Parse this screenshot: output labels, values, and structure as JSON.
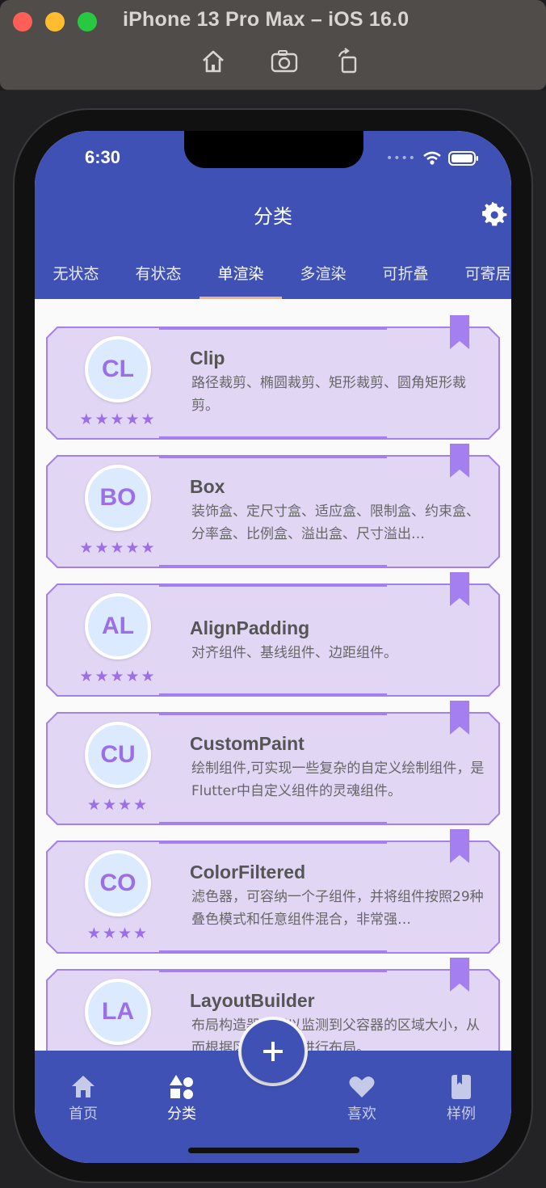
{
  "simulator": {
    "title": "iPhone 13 Pro Max – iOS 16.0",
    "tools": [
      "home-icon",
      "screenshot-icon",
      "rotate-icon"
    ]
  },
  "status_bar": {
    "time": "6:30"
  },
  "app_bar": {
    "title": "分类"
  },
  "tabs": [
    {
      "label": "无状态",
      "active": false
    },
    {
      "label": "有状态",
      "active": false
    },
    {
      "label": "单渲染",
      "active": true
    },
    {
      "label": "多渲染",
      "active": false
    },
    {
      "label": "可折叠",
      "active": false
    },
    {
      "label": "可寄居",
      "active": false
    }
  ],
  "items": [
    {
      "avatar": "CL",
      "title": "Clip",
      "stars": "★★★★★",
      "description": "路径裁剪、椭圆裁剪、矩形裁剪、圆角矩形裁剪。"
    },
    {
      "avatar": "BO",
      "title": "Box",
      "stars": "★★★★★",
      "description": "装饰盒、定尺寸盒、适应盒、限制盒、约束盒、分率盒、比例盒、溢出盒、尺寸溢出…"
    },
    {
      "avatar": "AL",
      "title": "AlignPadding",
      "stars": "★★★★★",
      "description": "对齐组件、基线组件、边距组件。"
    },
    {
      "avatar": "CU",
      "title": "CustomPaint",
      "stars": "★★★★",
      "description": "绘制组件,可实现一些复杂的自定义绘制组件，是Flutter中自定义组件的灵魂组件。"
    },
    {
      "avatar": "CO",
      "title": "ColorFiltered",
      "stars": "★★★★",
      "description": "滤色器，可容纳一个子组件，并将组件按照29种叠色模式和任意组件混合，非常强…"
    },
    {
      "avatar": "LA",
      "title": "LayoutBuilder",
      "stars": "★★★★",
      "description": "布局构造器，可以监测到父容器的区域大小，从而根据区域大小来进行布局。"
    }
  ],
  "bottom_nav": {
    "home": "首页",
    "category": "分类",
    "favorite": "喜欢",
    "sample": "样例"
  },
  "colors": {
    "primary": "#3f51b5",
    "card_fill": "#e1d7f5",
    "card_border": "#a37ff0",
    "accent": "#9c6ee8",
    "tab_indicator": "#f3b27a"
  }
}
